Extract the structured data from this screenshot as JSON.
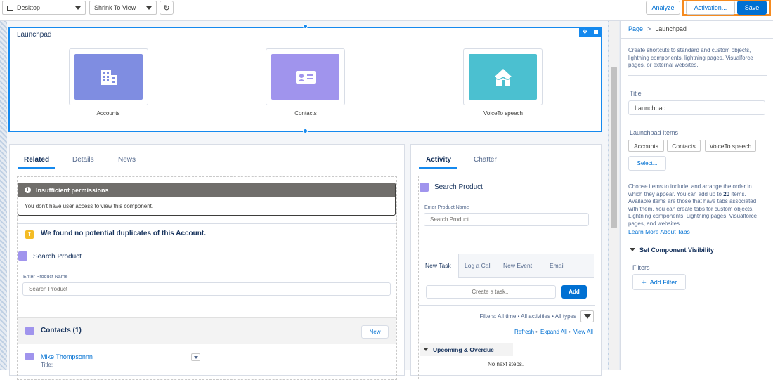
{
  "toolbar": {
    "device_label": "Desktop",
    "zoom_label": "Shrink To View",
    "analyze_label": "Analyze",
    "activation_label": "Activation...",
    "save_label": "Save"
  },
  "launchpad": {
    "title": "Launchpad",
    "tiles": [
      {
        "label": "Accounts",
        "color": "#7f8de1",
        "icon": "building-icon"
      },
      {
        "label": "Contacts",
        "color": "#a094ed",
        "icon": "contact-card-icon"
      },
      {
        "label": "VoiceTo speech",
        "color": "#4bc0d0",
        "icon": "house-icon"
      }
    ]
  },
  "left_card": {
    "tabs": [
      "Related",
      "Details",
      "News"
    ],
    "warning_title": "Insufficient permissions",
    "warning_text": "You don't have user access to view this component.",
    "duplicate_text": "We found no potential duplicates of this Account.",
    "search_title": "Search Product",
    "search_label": "Enter Product Name",
    "search_placeholder": "Search Product",
    "contacts_title": "Contacts (1)",
    "new_label": "New",
    "contact_name": "Mike Thompsonnn",
    "contact_field": "Title:"
  },
  "right_card": {
    "tabs": [
      "Activity",
      "Chatter"
    ],
    "search_title": "Search Product",
    "search_label": "Enter Product Name",
    "search_placeholder": "Search Product",
    "action_tabs": [
      "New Task",
      "Log a Call",
      "New Event",
      "Email"
    ],
    "task_placeholder": "Create a task...",
    "add_label": "Add",
    "filters_text": "Filters: All time • All activities • All types",
    "refresh_label": "Refresh",
    "expand_label": "Expand All",
    "view_all_label": "View All",
    "upcoming_label": "Upcoming & Overdue",
    "no_steps": "No next steps."
  },
  "properties": {
    "breadcrumb_root": "Page",
    "breadcrumb_sep": ">",
    "breadcrumb_current": "Launchpad",
    "description": "Create shortcuts to standard and custom objects, lightning components, lightning pages, Visualforce pages, or external websites.",
    "title_label": "Title",
    "title_value": "Launchpad",
    "items_label": "Launchpad Items",
    "items": [
      "Accounts",
      "Contacts",
      "VoiceTo speech"
    ],
    "select_label": "Select...",
    "help_text_1": "Choose items to include, and arrange the order in which they appear. You can add up to ",
    "help_text_bold": "20",
    "help_text_2": " items. Available items are those that have tabs associated with them. You can create tabs for custom objects, Lightning components, Lightning pages, Visualforce pages, and websites.",
    "learn_more": "Learn More About Tabs",
    "visibility_label": "Set Component Visibility",
    "filters_label": "Filters",
    "add_filter_label": "Add Filter"
  },
  "colors": {
    "brand": "#0070d2",
    "selection": "#1589ee",
    "highlight": "#f68b1f",
    "warning_bg": "#706e6b",
    "duplicate_icon": "#f4bc25"
  }
}
